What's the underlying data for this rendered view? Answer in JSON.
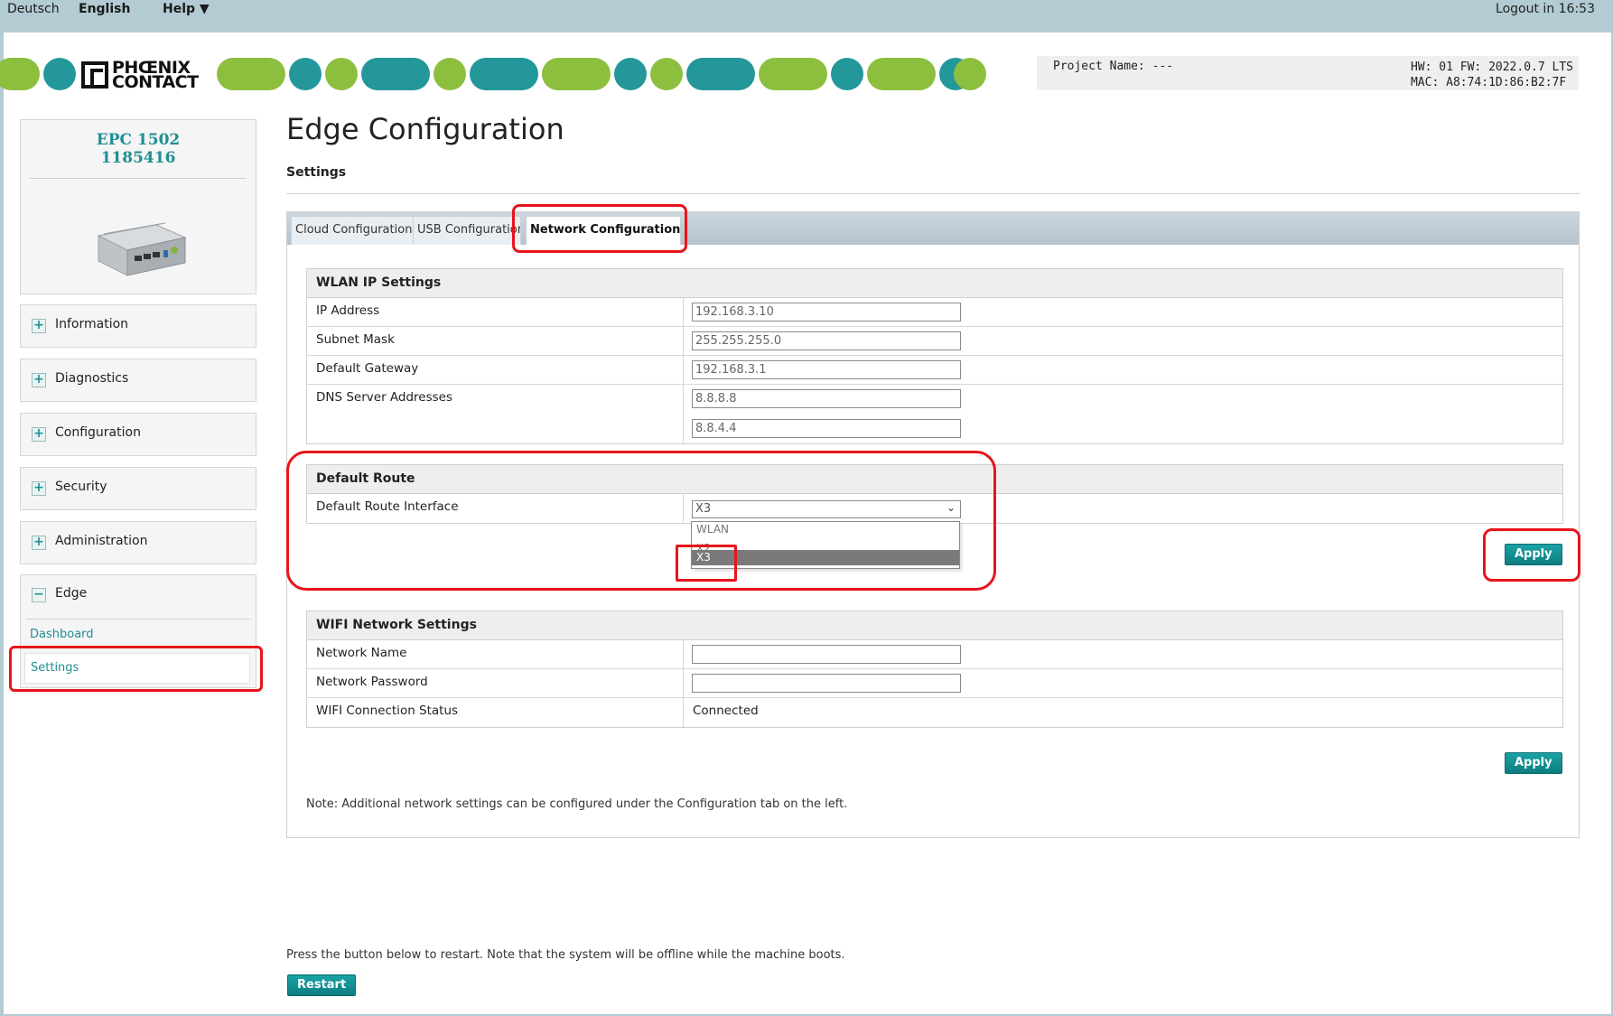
{
  "topbar": {
    "lang_de": "Deutsch",
    "lang_en": "English",
    "help": "Help ▼",
    "logout": "Logout in 16:53"
  },
  "brand": {
    "logo_line1": "PHŒNIX",
    "logo_line2": "CONTACT",
    "colors": {
      "green": "#8dbf3f",
      "teal": "#23979a"
    }
  },
  "header_info": {
    "project": "Project Name: ---",
    "hw": "HW: 01 FW: 2022.0.7 LTS",
    "mac": "MAC: A8:74:1D:86:B2:7F"
  },
  "device": {
    "model": "EPC 1502",
    "part": "1185416"
  },
  "sidebar": {
    "items": [
      {
        "label": "Information"
      },
      {
        "label": "Diagnostics"
      },
      {
        "label": "Configuration"
      },
      {
        "label": "Security"
      },
      {
        "label": "Administration"
      }
    ],
    "edge": {
      "label": "Edge",
      "sub": [
        "Dashboard",
        "Settings"
      ]
    }
  },
  "main": {
    "title": "Edge Configuration",
    "subtitle": "Settings",
    "tabs": [
      "Cloud Configuration",
      "USB Configuration",
      "Network Configuration"
    ],
    "wlan": {
      "heading": "WLAN IP Settings",
      "ip_label": "IP Address",
      "ip_value": "192.168.3.10",
      "mask_label": "Subnet Mask",
      "mask_value": "255.255.255.0",
      "gw_label": "Default Gateway",
      "gw_value": "192.168.3.1",
      "dns_label": "DNS Server Addresses",
      "dns1": "8.8.8.8",
      "dns2": "8.8.4.4"
    },
    "route": {
      "heading": "Default Route",
      "iface_label": "Default Route Interface",
      "selected": "X3",
      "options": [
        "WLAN",
        "X2",
        "X3"
      ]
    },
    "apply": "Apply",
    "wifi": {
      "heading": "WIFI Network Settings",
      "name_label": "Network Name",
      "name_value": "",
      "pass_label": "Network Password",
      "pass_value": "",
      "status_label": "WIFI Connection Status",
      "status_value": "Connected"
    },
    "note": "Note: Additional network settings can be configured under the Configuration tab on the left.",
    "restart_note": "Press the button below to restart. Note that the system will be offline while the machine boots.",
    "restart": "Restart"
  },
  "highlight_color": "#e8141c"
}
